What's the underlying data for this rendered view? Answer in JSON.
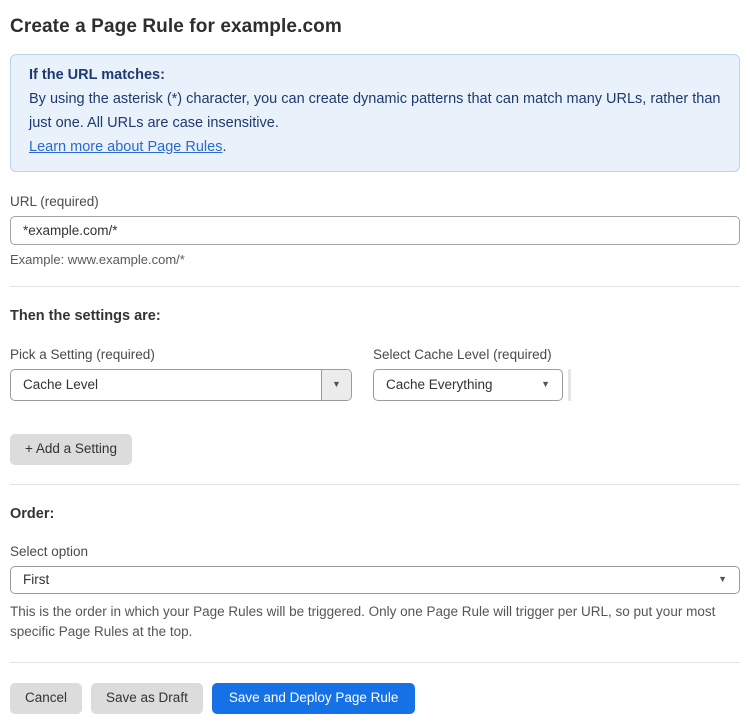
{
  "page": {
    "title": "Create a Page Rule for example.com"
  },
  "info_box": {
    "heading": "If the URL matches:",
    "body": "By using the asterisk (*) character, you can create dynamic patterns that can match many URLs, rather than just one. All URLs are case insensitive.",
    "link_label": "Learn more about Page Rules",
    "link_suffix": "."
  },
  "url_field": {
    "label": "URL (required)",
    "value": "*example.com/*",
    "helper": "Example: www.example.com/*"
  },
  "settings": {
    "heading": "Then the settings are:",
    "setting_picker": {
      "label": "Pick a Setting (required)",
      "value": "Cache Level"
    },
    "cache_level_picker": {
      "label": "Select Cache Level (required)",
      "value": "Cache Everything"
    },
    "add_button_label": "+ Add a Setting"
  },
  "order": {
    "heading": "Order:",
    "label": "Select option",
    "value": "First",
    "helper": "This is the order in which your Page Rules will be triggered. Only one Page Rule will trigger per URL, so put your most specific Page Rules at the top."
  },
  "actions": {
    "cancel_label": "Cancel",
    "save_draft_label": "Save as Draft",
    "save_deploy_label": "Save and Deploy Page Rule"
  },
  "icons": {
    "dropdown_arrow": "▼"
  },
  "colors": {
    "info_bg": "#e9f1fb",
    "info_border": "#b9d3f1",
    "info_text": "#1e3a6e",
    "link": "#2a6ad0",
    "primary_button": "#1671e6",
    "secondary_button": "#dcdcdc"
  }
}
